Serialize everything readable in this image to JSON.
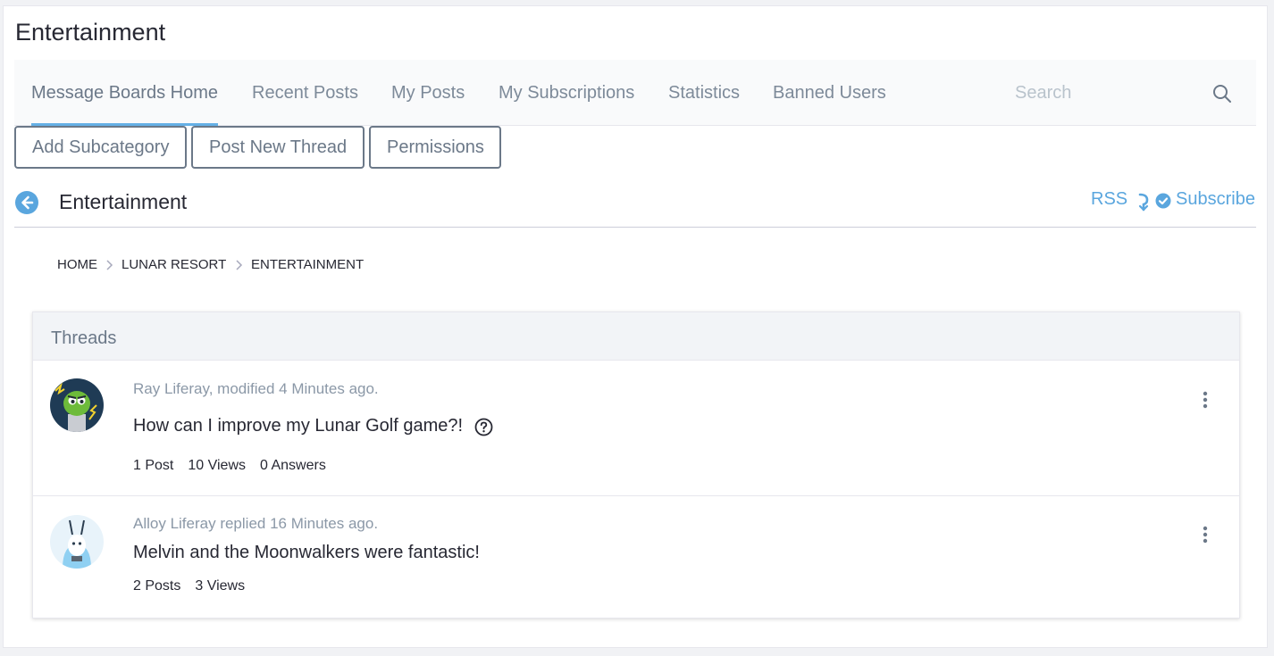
{
  "portlet": {
    "title": "Entertainment"
  },
  "nav": {
    "items": [
      {
        "label": "Message Boards Home",
        "active": true
      },
      {
        "label": "Recent Posts"
      },
      {
        "label": "My Posts"
      },
      {
        "label": "My Subscriptions"
      },
      {
        "label": "Statistics"
      },
      {
        "label": "Banned Users"
      }
    ],
    "search": {
      "placeholder": "Search",
      "value": "",
      "icon": "search-icon"
    }
  },
  "actions": {
    "add_subcategory": "Add Subcategory",
    "post_new_thread": "Post New Thread",
    "permissions": "Permissions"
  },
  "header": {
    "title": "Entertainment",
    "rss": "RSS",
    "subscribe": "Subscribe",
    "back_icon": "arrow-left-circle-icon"
  },
  "breadcrumb": [
    "HOME",
    "LUNAR RESORT",
    "ENTERTAINMENT"
  ],
  "threads_panel": {
    "title": "Threads",
    "threads": [
      {
        "meta": "Ray Liferay, modified 4 Minutes ago.",
        "title": "How can I improve my Lunar Golf game?!",
        "question": true,
        "stats": [
          "1 Post",
          "10 Views",
          "0 Answers"
        ]
      },
      {
        "meta": "Alloy Liferay replied 16 Minutes ago.",
        "title": "Melvin and the Moonwalkers were fantastic!",
        "question": false,
        "stats": [
          "2 Posts",
          "3 Views"
        ]
      }
    ]
  },
  "colors": {
    "accent": "#65b0e6",
    "link": "#5aa6de",
    "muted": "#6b7888"
  }
}
